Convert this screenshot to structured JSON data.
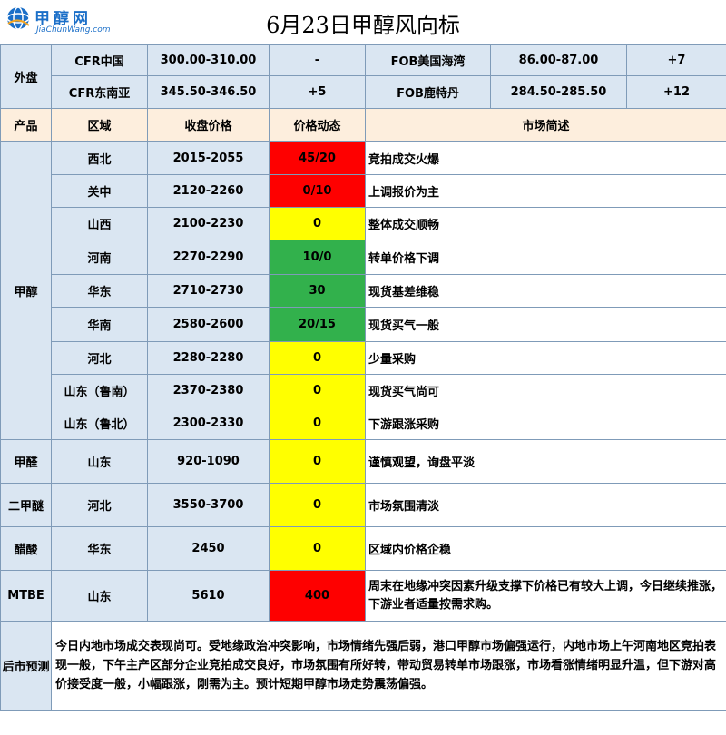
{
  "header": {
    "logo_text": "甲醇网",
    "logo_url_text": "JiaChunWang.com",
    "title": "6月23日甲醇风向标"
  },
  "external": {
    "label": "外盘",
    "rows": [
      {
        "market": "CFR中国",
        "price": "300.00-310.00",
        "change": "-",
        "market2": "FOB美国海湾",
        "price2": "86.00-87.00",
        "change2": "+7"
      },
      {
        "market": "CFR东南亚",
        "price": "345.50-346.50",
        "change": "+5",
        "market2": "FOB鹿特丹",
        "price2": "284.50-285.50",
        "change2": "+12"
      }
    ]
  },
  "columns": {
    "product": "产品",
    "region": "区域",
    "price": "收盘价格",
    "dynamic": "价格动态",
    "summary": "市场简述"
  },
  "methanol": {
    "product": "甲醇",
    "rows": [
      {
        "region": "西北",
        "price": "2015-2055",
        "dynamic": "45/20",
        "color": "#fe0000",
        "summary": "竞拍成交火爆"
      },
      {
        "region": "关中",
        "price": "2120-2260",
        "dynamic": "0/10",
        "color": "#fe0000",
        "summary": "上调报价为主"
      },
      {
        "region": "山西",
        "price": "2100-2230",
        "dynamic": "0",
        "color": "#ffff00",
        "summary": "整体成交顺畅"
      },
      {
        "region": "河南",
        "price": "2270-2290",
        "dynamic": "10/0",
        "color": "#32b14c",
        "summary": "转单价格下调"
      },
      {
        "region": "华东",
        "price": "2710-2730",
        "dynamic": "30",
        "color": "#32b14c",
        "summary": "现货基差维稳"
      },
      {
        "region": "华南",
        "price": "2580-2600",
        "dynamic": "20/15",
        "color": "#32b14c",
        "summary": "现货买气一般"
      },
      {
        "region": "河北",
        "price": "2280-2280",
        "dynamic": "0",
        "color": "#ffff00",
        "summary": "少量采购"
      },
      {
        "region": "山东（鲁南）",
        "price": "2370-2380",
        "dynamic": "0",
        "color": "#ffff00",
        "summary": "现货买气尚可"
      },
      {
        "region": "山东（鲁北）",
        "price": "2300-2330",
        "dynamic": "0",
        "color": "#ffff00",
        "summary": "下游跟涨采购"
      }
    ]
  },
  "others": [
    {
      "product": "甲醛",
      "region": "山东",
      "price": "920-1090",
      "dynamic": "0",
      "color": "#ffff00",
      "summary": "谨慎观望，询盘平淡"
    },
    {
      "product": "二甲醚",
      "region": "河北",
      "price": "3550-3700",
      "dynamic": "0",
      "color": "#ffff00",
      "summary": "市场氛围清淡"
    },
    {
      "product": "醋酸",
      "region": "华东",
      "price": "2450",
      "dynamic": "0",
      "color": "#ffff00",
      "summary": "区域内价格企稳"
    },
    {
      "product": "MTBE",
      "region": "山东",
      "price": "5610",
      "dynamic": "400",
      "color": "#fe0000",
      "summary": "周末在地缘冲突因素升级支撑下价格已有较大上调，今日继续推涨，下游业者适量按需求购。"
    }
  ],
  "forecast": {
    "label": "后市预测",
    "text": "今日内地市场成交表现尚可。受地缘政治冲突影响，市场情绪先强后弱，港口甲醇市场偏强运行，内地市场上午河南地区竞拍表现一般，下午主产区部分企业竞拍成交良好，市场氛围有所好转，带动贸易转单市场跟涨，市场看涨情绪明显升温，但下游对高价接受度一般，小幅跟涨，刚需为主。预计短期甲醇市场走势震荡偏强。"
  }
}
